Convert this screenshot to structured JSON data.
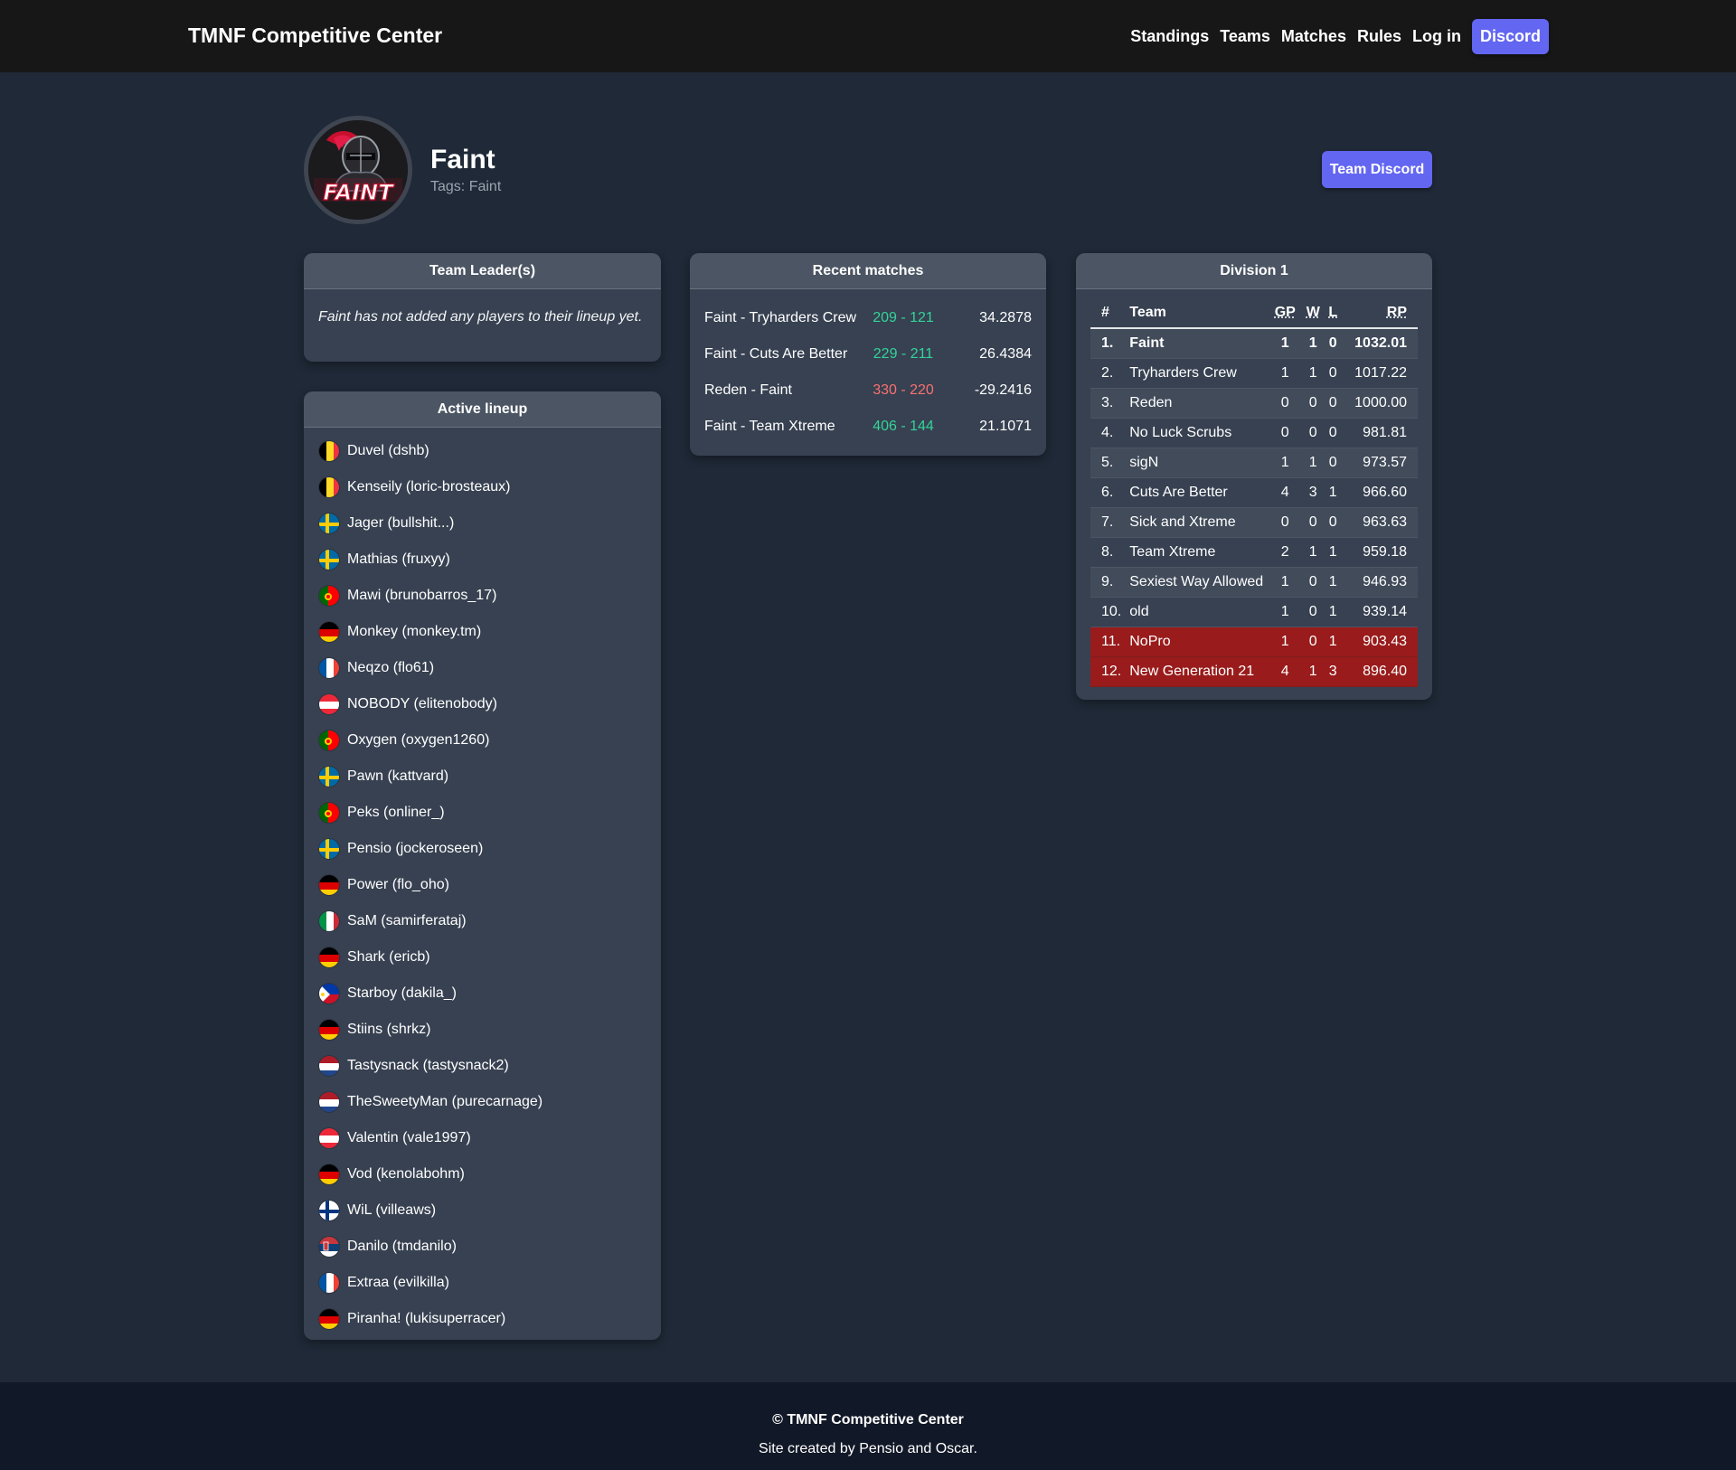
{
  "navbar": {
    "brand": "TMNF Competitive Center",
    "links": [
      "Standings",
      "Teams",
      "Matches",
      "Rules",
      "Log in"
    ],
    "discord_label": "Discord"
  },
  "team": {
    "name": "Faint",
    "tags_label": "Tags:",
    "tags_value": "Faint",
    "discord_label": "Team Discord",
    "logo_text": "FAINT"
  },
  "leaders": {
    "title": "Team Leader(s)",
    "empty_text": "Faint has not added any players to their lineup yet."
  },
  "lineup": {
    "title": "Active lineup",
    "players": [
      {
        "name": "Duvel (dshb)",
        "flag": "be"
      },
      {
        "name": "Kenseily (loric-brosteaux)",
        "flag": "be"
      },
      {
        "name": "Jager (bullshit...)",
        "flag": "se"
      },
      {
        "name": "Mathias (fruxyy)",
        "flag": "se"
      },
      {
        "name": "Mawi (brunobarros_17)",
        "flag": "pt"
      },
      {
        "name": "Monkey (monkey.tm)",
        "flag": "de"
      },
      {
        "name": "Neqzo (flo61)",
        "flag": "fr"
      },
      {
        "name": "NOBODY (elitenobody)",
        "flag": "at"
      },
      {
        "name": "Oxygen (oxygen1260)",
        "flag": "pt"
      },
      {
        "name": "Pawn (kattvard)",
        "flag": "se"
      },
      {
        "name": "Peks (onliner_)",
        "flag": "pt"
      },
      {
        "name": "Pensio (jockeroseen)",
        "flag": "se"
      },
      {
        "name": "Power (flo_oho)",
        "flag": "de"
      },
      {
        "name": "SaM (samirferataj)",
        "flag": "it"
      },
      {
        "name": "Shark (ericb)",
        "flag": "de"
      },
      {
        "name": "Starboy (dakila_)",
        "flag": "ph"
      },
      {
        "name": "Stiins (shrkz)",
        "flag": "de"
      },
      {
        "name": "Tastysnack (tastysnack2)",
        "flag": "nl"
      },
      {
        "name": "TheSweetyMan (purecarnage)",
        "flag": "nl"
      },
      {
        "name": "Valentin (vale1997)",
        "flag": "at"
      },
      {
        "name": "Vod (kenolabohm)",
        "flag": "de"
      },
      {
        "name": "WiL (villeaws)",
        "flag": "fi"
      },
      {
        "name": "Danilo (tmdanilo)",
        "flag": "rs"
      },
      {
        "name": "Extraa (evilkilla)",
        "flag": "fr"
      },
      {
        "name": "Piranha! (lukisuperracer)",
        "flag": "de"
      }
    ]
  },
  "matches": {
    "title": "Recent matches",
    "rows": [
      {
        "teams": "Faint - Tryharders Crew",
        "score": "209 - 121",
        "rp": "34.2878",
        "result": "win"
      },
      {
        "teams": "Faint - Cuts Are Better",
        "score": "229 - 211",
        "rp": "26.4384",
        "result": "win"
      },
      {
        "teams": "Reden - Faint",
        "score": "330 - 220",
        "rp": "-29.2416",
        "result": "loss"
      },
      {
        "teams": "Faint - Team Xtreme",
        "score": "406 - 144",
        "rp": "21.1071",
        "result": "win"
      }
    ]
  },
  "division": {
    "title": "Division 1",
    "columns": [
      "#",
      "Team",
      "GP",
      "W",
      "L",
      "RP"
    ],
    "rows": [
      {
        "rank": "1.",
        "team": "Faint",
        "gp": "1",
        "w": "1",
        "l": "0",
        "rp": "1032.01",
        "highlight": true,
        "relegation": false
      },
      {
        "rank": "2.",
        "team": "Tryharders Crew",
        "gp": "1",
        "w": "1",
        "l": "0",
        "rp": "1017.22",
        "highlight": false,
        "relegation": false
      },
      {
        "rank": "3.",
        "team": "Reden",
        "gp": "0",
        "w": "0",
        "l": "0",
        "rp": "1000.00",
        "highlight": false,
        "relegation": false
      },
      {
        "rank": "4.",
        "team": "No Luck Scrubs",
        "gp": "0",
        "w": "0",
        "l": "0",
        "rp": "981.81",
        "highlight": false,
        "relegation": false
      },
      {
        "rank": "5.",
        "team": "sigN",
        "gp": "1",
        "w": "1",
        "l": "0",
        "rp": "973.57",
        "highlight": false,
        "relegation": false
      },
      {
        "rank": "6.",
        "team": "Cuts Are Better",
        "gp": "4",
        "w": "3",
        "l": "1",
        "rp": "966.60",
        "highlight": false,
        "relegation": false
      },
      {
        "rank": "7.",
        "team": "Sick and Xtreme",
        "gp": "0",
        "w": "0",
        "l": "0",
        "rp": "963.63",
        "highlight": false,
        "relegation": false
      },
      {
        "rank": "8.",
        "team": "Team Xtreme",
        "gp": "2",
        "w": "1",
        "l": "1",
        "rp": "959.18",
        "highlight": false,
        "relegation": false
      },
      {
        "rank": "9.",
        "team": "Sexiest Way Allowed",
        "gp": "1",
        "w": "0",
        "l": "1",
        "rp": "946.93",
        "highlight": false,
        "relegation": false
      },
      {
        "rank": "10.",
        "team": "old",
        "gp": "1",
        "w": "0",
        "l": "1",
        "rp": "939.14",
        "highlight": false,
        "relegation": false
      },
      {
        "rank": "11.",
        "team": "NoPro",
        "gp": "1",
        "w": "0",
        "l": "1",
        "rp": "903.43",
        "highlight": false,
        "relegation": true
      },
      {
        "rank": "12.",
        "team": "New Generation 21",
        "gp": "4",
        "w": "1",
        "l": "3",
        "rp": "896.40",
        "highlight": false,
        "relegation": true
      }
    ]
  },
  "footer": {
    "copyright": "© TMNF Competitive Center",
    "credit": "Site created by Pensio and Oscar."
  },
  "colors": {
    "background": "#1f2937",
    "navbar": "#171717",
    "card": "#374151",
    "card_header": "#4b5563",
    "accent": "#6366f1",
    "win": "#34d399",
    "loss": "#f87171",
    "relegation": "#991b1b",
    "footer": "#111827"
  }
}
